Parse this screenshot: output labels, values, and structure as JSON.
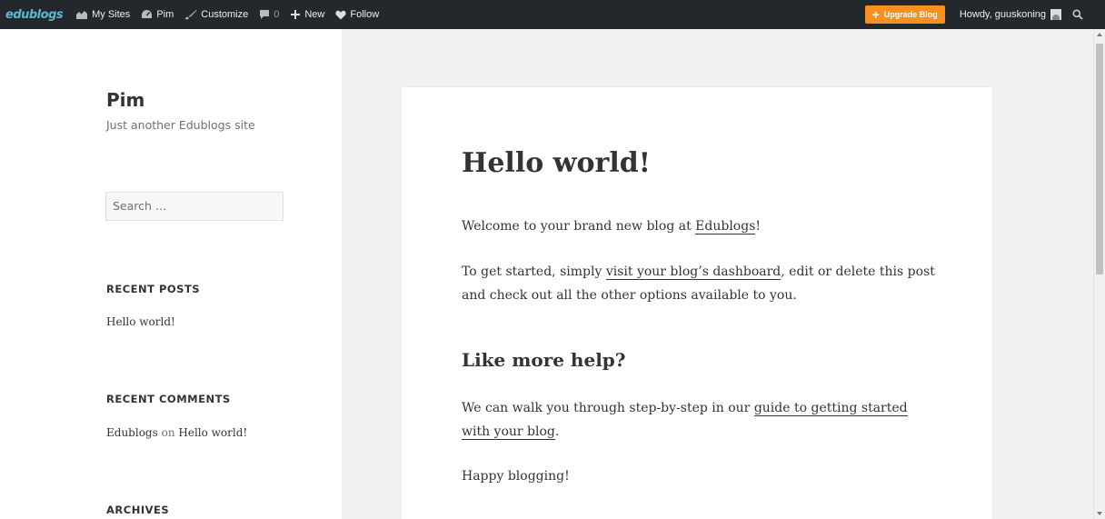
{
  "adminbar": {
    "logo": "edublogs",
    "my_sites": "My Sites",
    "site_name": "Pim",
    "customize": "Customize",
    "comments_count": "0",
    "new": "New",
    "follow": "Follow",
    "upgrade": "Upgrade Blog",
    "howdy": "Howdy, guuskoning"
  },
  "sidebar": {
    "site_title": "Pim",
    "site_description": "Just another Edublogs site",
    "search_placeholder": "Search …",
    "recent_posts_title": "RECENT POSTS",
    "recent_posts": [
      "Hello world!"
    ],
    "recent_comments_title": "RECENT COMMENTS",
    "recent_comment": {
      "author": "Edublogs",
      "on": "on",
      "post": "Hello world!"
    },
    "archives_title": "ARCHIVES"
  },
  "article": {
    "title": "Hello world!",
    "p1_text": "Welcome to your brand new blog at ",
    "p1_link": "Edublogs",
    "p1_end": "!",
    "p2_text": "To get started, simply ",
    "p2_link": "visit your blog’s dashboard",
    "p2_end": ", edit or delete this post and check out all the other options available to you.",
    "h2": "Like more help?",
    "p3_text": "We can walk you through step-by-step in our ",
    "p3_link": "guide to getting started with your blog",
    "p3_end": ".",
    "p4": "Happy blogging!"
  },
  "colors": {
    "adminbar_bg": "#23282d",
    "upgrade_accent": "#f7901e",
    "logo_color": "#5fb7d4"
  }
}
